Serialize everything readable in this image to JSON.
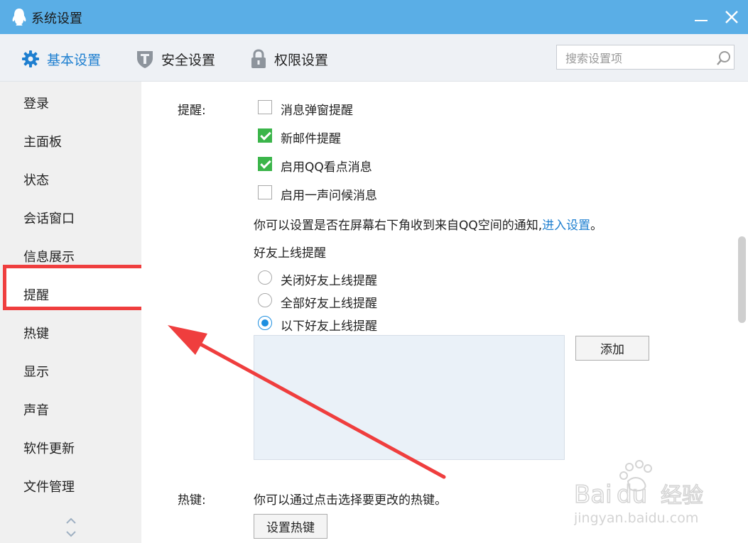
{
  "window": {
    "title": "系统设置"
  },
  "toolbar": {
    "tabs": [
      {
        "label": "基本设置",
        "icon": "gear-icon",
        "active": true
      },
      {
        "label": "安全设置",
        "icon": "shield-icon",
        "active": false
      },
      {
        "label": "权限设置",
        "icon": "lock-icon",
        "active": false
      }
    ],
    "search_placeholder": "搜索设置项"
  },
  "sidebar": {
    "items": [
      "登录",
      "主面板",
      "状态",
      "会话窗口",
      "信息展示",
      "提醒",
      "热键",
      "显示",
      "声音",
      "软件更新",
      "文件管理"
    ],
    "selected": "提醒"
  },
  "content": {
    "reminder_label": "提醒:",
    "checkboxes": [
      {
        "label": "消息弹窗提醒",
        "checked": false
      },
      {
        "label": "新邮件提醒",
        "checked": true
      },
      {
        "label": "启用QQ看点消息",
        "checked": true
      },
      {
        "label": "启用一声问候消息",
        "checked": false
      }
    ],
    "qzone_text": "你可以设置是否在屏幕右下角收到来自QQ空间的通知,",
    "qzone_link": "进入设置",
    "qzone_end": "。",
    "friend_online_title": "好友上线提醒",
    "radios": [
      {
        "label": "关闭好友上线提醒",
        "checked": false
      },
      {
        "label": "全部好友上线提醒",
        "checked": false
      },
      {
        "label": "以下好友上线提醒",
        "checked": true
      }
    ],
    "add_button": "添加",
    "hotkey_label": "热键:",
    "hotkey_text": "你可以通过点击选择要更改的热键。",
    "hotkey_button": "设置热键"
  },
  "watermark": {
    "text": "Baidu经验",
    "url_text": "jingyan.baidu.com"
  },
  "colors": {
    "titlebar": "#5aaee6",
    "accent": "#1e7fd0",
    "highlight": "#ef3e3e",
    "check": "#3bb54a"
  }
}
